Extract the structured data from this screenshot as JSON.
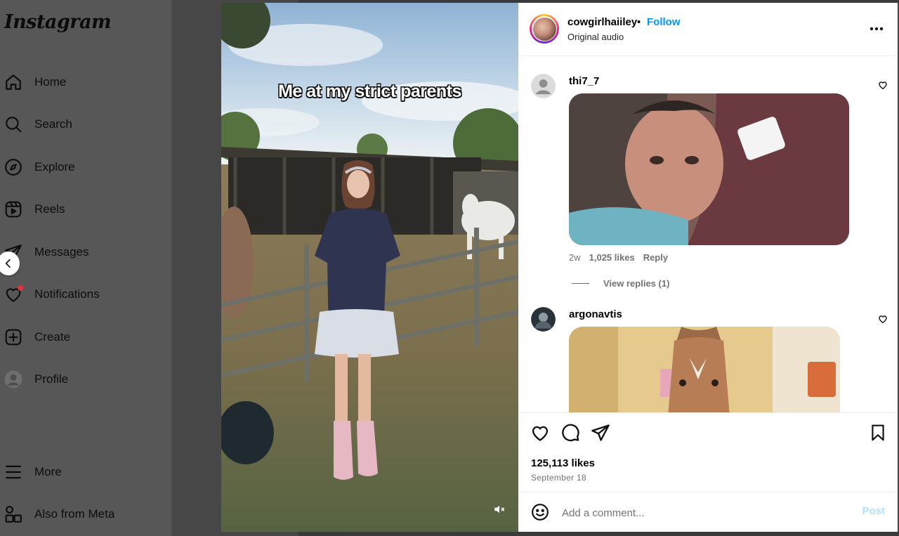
{
  "brand": {
    "logo_text": "Instagram"
  },
  "sidebar": {
    "items": [
      {
        "label": "Home",
        "icon": "home-icon"
      },
      {
        "label": "Search",
        "icon": "search-icon"
      },
      {
        "label": "Explore",
        "icon": "compass-icon"
      },
      {
        "label": "Reels",
        "icon": "reels-icon"
      },
      {
        "label": "Messages",
        "icon": "paper-plane-icon"
      },
      {
        "label": "Notifications",
        "icon": "heart-icon",
        "has_badge": true
      },
      {
        "label": "Create",
        "icon": "plus-square-icon"
      },
      {
        "label": "Profile",
        "icon": "profile-avatar-icon"
      },
      {
        "label": "More",
        "icon": "hamburger-icon"
      },
      {
        "label": "Also from Meta",
        "icon": "meta-shapes-icon"
      }
    ]
  },
  "video": {
    "caption": "Me at my strict parents",
    "muted": true
  },
  "post": {
    "username": "cowgirlhaiiley",
    "separator": "•",
    "follow_label": "Follow",
    "audio_label": "Original audio",
    "likes": "125,113 likes",
    "date": "September 18"
  },
  "comments": [
    {
      "username": "thi7_7",
      "type": "gif",
      "time": "2w",
      "likes": "1,025 likes",
      "reply_label": "Reply",
      "view_replies": "View replies (1)"
    },
    {
      "username": "argonavtis",
      "type": "gif"
    }
  ],
  "comment_box": {
    "placeholder": "Add a comment...",
    "post_label": "Post"
  },
  "colors": {
    "accent": "#0095f6",
    "post_disabled": "#b2dffc",
    "sidebar_bg": "#575757",
    "notification_dot": "#e0313c"
  }
}
